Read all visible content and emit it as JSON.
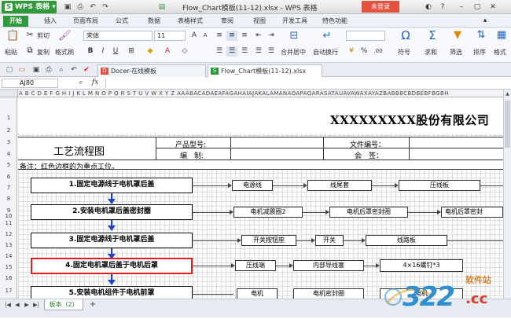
{
  "app": {
    "name": "WPS 表格",
    "window_title": "Flow_Chart模板(11-12).xlsx - WPS 表格",
    "login_label": "未登录"
  },
  "menu": [
    "开始",
    "插入",
    "页面布局",
    "公式",
    "数据",
    "表格样式",
    "审阅",
    "视图",
    "开发工具",
    "特色功能"
  ],
  "ribbon": {
    "paste": "粘贴",
    "cut": "剪切",
    "copy": "复制",
    "format_painter": "格式刷",
    "font_name": "宋体",
    "font_size": "11",
    "merge_center": "合并居中",
    "wrap_text": "自动换行",
    "symbol": "符号",
    "sum": "求和",
    "filter": "筛选",
    "sort": "排序",
    "format": "格式"
  },
  "doc_tabs": [
    {
      "label": "Docer-在线模板",
      "icon_color": "#e3513f"
    },
    {
      "label": "Flow_Chart模板(11-12).xlsx",
      "icon_color": "#2f9a3a"
    }
  ],
  "formula": {
    "cell_ref": "AJ80",
    "fx": "fx"
  },
  "columns": "A B C D E F G H I J K L M N O P Q R S T U V W X Y Z AAABACADAEAFAGAHAIAJAKALAMANAOAPAQARASATAUAVAWAXAYAZBABBBCBDBEBFBGBH",
  "rows": [
    "1",
    "2",
    "3",
    "4",
    "5",
    "6",
    "7",
    "8",
    "9",
    "10",
    "11",
    "12",
    "13",
    "14",
    "15",
    "16",
    "17"
  ],
  "sheet": {
    "company": "XXXXXXXXX股份有限公司",
    "process_title": "工艺流程图",
    "product_model_label": "产品型号:",
    "file_no_label": "文件编号：",
    "prepared_label": "编　制:",
    "signed_label": "会　签：",
    "note": "备注：红色边框的为重点工位。"
  },
  "steps": [
    {
      "title": "1.固定电源线于电机罩后盖",
      "highlight": false,
      "items": [
        "电源线",
        "线尾套",
        "压线板"
      ]
    },
    {
      "title": "2.安装电机罩后盖密封圈",
      "highlight": false,
      "items": [
        "电机减震圈2",
        "电机后罩密封圈",
        "电机后罩密封"
      ]
    },
    {
      "title": "3.固定电源线于电机罩后盖",
      "highlight": false,
      "items": [
        "开关按钮座",
        "开关",
        "线路板"
      ]
    },
    {
      "title": "4.固定电机罩后盖于电机后罩",
      "highlight": true,
      "items": [
        "压线端",
        "内部导线塞",
        "4×16螺钉*3"
      ]
    },
    {
      "title": "5.安装电机组件于电机前罩",
      "highlight": false,
      "items": [
        "电机",
        "电机密封圈",
        "电机"
      ]
    }
  ],
  "sheet_tab": "板本（2）",
  "watermark": {
    "brand": "软件站",
    "number": "322",
    "suffix": ".cc"
  }
}
